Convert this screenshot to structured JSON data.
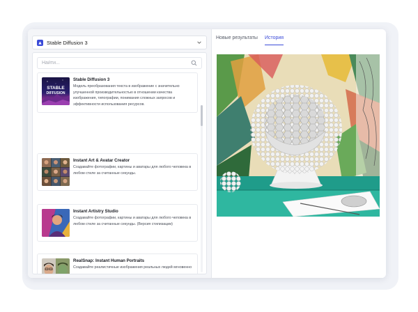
{
  "model_selector": {
    "label": "Stable Diffusion 3"
  },
  "search": {
    "placeholder": "Найти..."
  },
  "models": [
    {
      "title": "Stable Diffusion 3",
      "description": "Модель преобразования текста в изображение с значительно улучшенной производительностью в отношении качества изображения, типографии, понимания сложных запросов и эффективности использования ресурсов.",
      "thumb_text": "STABLE DIFFUSION"
    },
    {
      "title": "Instant Art & Avatar Creator",
      "description": "Создавайте фотографии, картины и аватары для любого человека в любом стиле за считанные секунды."
    },
    {
      "title": "Instant Artistry Studio",
      "description": "Создавайте фотографии, картины и аватары для любого человека в любом стиле за считанные секунды. (Версия стилизации)"
    },
    {
      "title": "RealSnap: Instant Human Portraits",
      "description": "Создавайте реалистичные изображения реальных людей мгновенно"
    }
  ],
  "tabs": [
    {
      "label": "Новые результаты",
      "active": false
    },
    {
      "label": "История",
      "active": true
    }
  ],
  "colors": {
    "accent": "#3b4bd8",
    "background": "#f0f2f7"
  }
}
